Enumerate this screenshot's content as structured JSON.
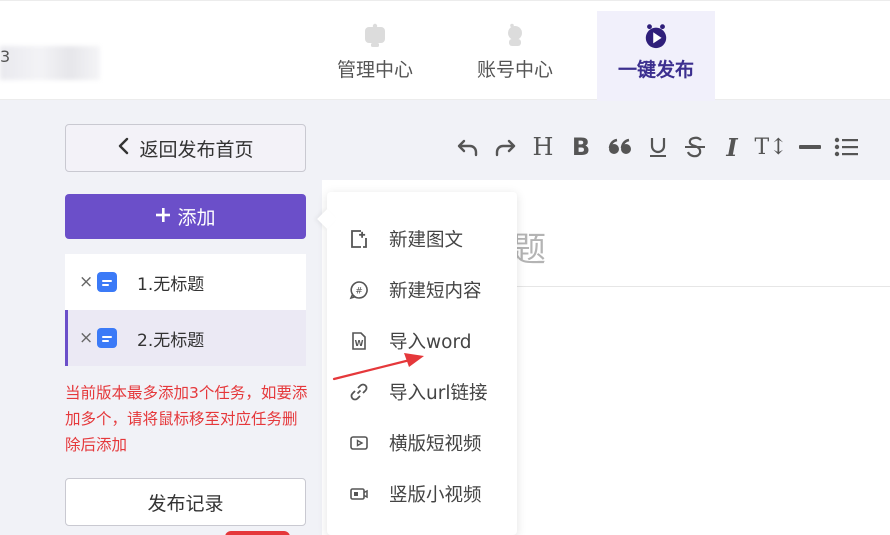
{
  "header": {
    "brand_char": "3",
    "nav": [
      {
        "label": "管理中心",
        "icon": "management-center-icon"
      },
      {
        "label": "账号中心",
        "icon": "account-center-icon"
      },
      {
        "label": "一键发布",
        "icon": "one-click-publish-icon",
        "active": true
      }
    ]
  },
  "sidebar": {
    "back_label": "返回发布首页",
    "add_label": "添加",
    "tasks": [
      {
        "close": "×",
        "label": "1.无标题"
      },
      {
        "close": "×",
        "label": "2.无标题",
        "selected": true
      }
    ],
    "notice": "当前版本最多添加3个任务，如要添加多个，请将鼠标移至对应任务删除后添加",
    "history_label": "发布记录"
  },
  "toolbar": {
    "items": [
      "undo-icon",
      "redo-icon",
      "heading-icon",
      "bold-icon",
      "quote-icon",
      "underline-icon",
      "strikethrough-icon",
      "italic-icon",
      "font-size-icon",
      "horizontal-rule-icon",
      "bulleted-list-icon"
    ],
    "heading_glyph": "H",
    "bold_glyph": "B",
    "italic_glyph": "I",
    "font_size_glyph": "T↕"
  },
  "editor": {
    "title_placeholder_visible": "题"
  },
  "dropdown": {
    "items": [
      {
        "label": "新建图文",
        "icon": "new-article-icon"
      },
      {
        "label": "新建短内容",
        "icon": "new-short-content-icon"
      },
      {
        "label": "导入word",
        "icon": "import-word-icon"
      },
      {
        "label": "导入url链接",
        "icon": "import-url-link-icon"
      },
      {
        "label": "横版短视频",
        "icon": "landscape-video-icon"
      },
      {
        "label": "竖版小视频",
        "icon": "portrait-video-icon"
      }
    ]
  },
  "colors": {
    "accent": "#6b4fc9",
    "active_nav": "#3c2f8f",
    "notice_red": "#e5383b",
    "doc_blue": "#3b7af7",
    "annotation_arrow": "#e5383b"
  }
}
